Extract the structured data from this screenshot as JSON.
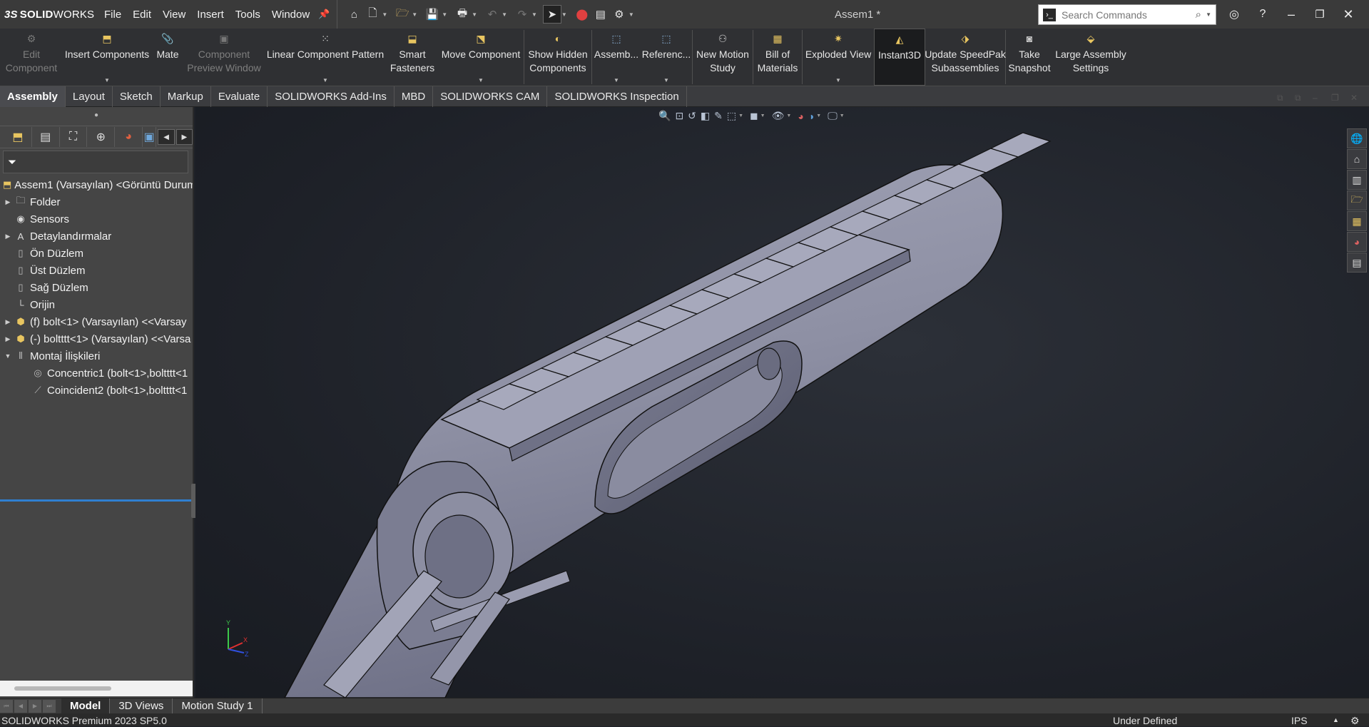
{
  "app": {
    "brand_ds": "3S",
    "brand_name": "SOLID",
    "brand_suffix": "WORKS",
    "doc_title": "Assem1 *"
  },
  "menu": [
    "File",
    "Edit",
    "View",
    "Insert",
    "Tools",
    "Window"
  ],
  "search": {
    "placeholder": "Search Commands"
  },
  "ribbon": {
    "edit_component": [
      "Edit",
      "Component"
    ],
    "insert_components": "Insert Components",
    "mate": "Mate",
    "component_preview": [
      "Component",
      "Preview Window"
    ],
    "linear_pattern": "Linear Component Pattern",
    "smart_fasteners": [
      "Smart",
      "Fasteners"
    ],
    "move_component": "Move Component",
    "show_hidden": [
      "Show Hidden",
      "Components"
    ],
    "assembly": "Assemb...",
    "reference": "Referenc...",
    "new_motion_study": [
      "New Motion",
      "Study"
    ],
    "bill_of_materials": [
      "Bill of",
      "Materials"
    ],
    "exploded_view": "Exploded View",
    "instant3d": "Instant3D",
    "update_speedpak": [
      "Update SpeedPak",
      "Subassemblies"
    ],
    "take_snapshot": [
      "Take",
      "Snapshot"
    ],
    "large_assembly": [
      "Large Assembly",
      "Settings"
    ]
  },
  "tabs": [
    "Assembly",
    "Layout",
    "Sketch",
    "Markup",
    "Evaluate",
    "SOLIDWORKS Add-Ins",
    "MBD",
    "SOLIDWORKS CAM",
    "SOLIDWORKS Inspection"
  ],
  "tree": {
    "root": "Assem1 (Varsayılan) <Görüntü Durum",
    "items": [
      {
        "label": "Folder"
      },
      {
        "label": "Sensors"
      },
      {
        "label": "Detaylandırmalar"
      },
      {
        "label": "Ön Düzlem"
      },
      {
        "label": "Üst Düzlem"
      },
      {
        "label": "Sağ Düzlem"
      },
      {
        "label": "Orijin"
      },
      {
        "label": "(f) bolt<1> (Varsayılan) <<Varsay"
      },
      {
        "label": "(-) boltttt<1> (Varsayılan) <<Varsa"
      },
      {
        "label": "Montaj İlişkileri"
      }
    ],
    "mates": [
      {
        "label": "Concentric1 (bolt<1>,boltttt<1"
      },
      {
        "label": "Coincident2 (bolt<1>,boltttt<1"
      }
    ]
  },
  "bottom_tabs": [
    "Model",
    "3D Views",
    "Motion Study 1"
  ],
  "status": {
    "version": "SOLIDWORKS Premium 2023 SP5.0",
    "state": "Under Defined",
    "units": "IPS"
  },
  "triad": {
    "x": "X",
    "y": "Y",
    "z": "Z"
  }
}
